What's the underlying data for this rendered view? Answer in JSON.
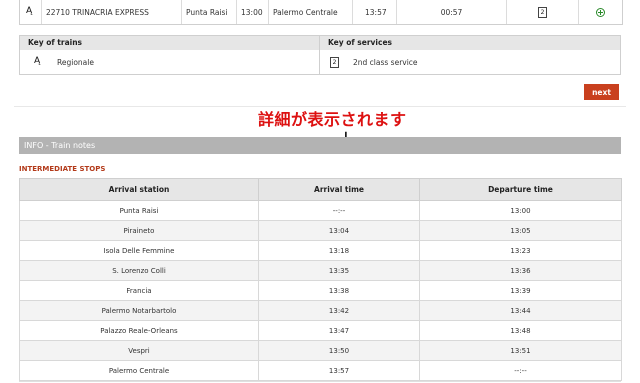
{
  "train_row": {
    "train": "22710 TRINACRIA EXPRESS",
    "from": "Punta Raisi",
    "departure": "13:00",
    "to": "Palermo Centrale",
    "arrival": "13:57",
    "duration": "00:57",
    "service_code": "2"
  },
  "key": {
    "trains_header": "Key of trains",
    "services_header": "Key of services",
    "train_label": "Regionale",
    "service_label": "2nd class service",
    "service_code": "2"
  },
  "next_button": "next",
  "annotation": {
    "text": "詳細が表示されます",
    "arrow": "↓"
  },
  "info_bar": "INFO - Train notes",
  "stops": {
    "title": "INTERMEDIATE STOPS",
    "columns": [
      "Arrival station",
      "Arrival time",
      "Departure time"
    ],
    "rows": [
      [
        "Punta Raisi",
        "--:--",
        "13:00"
      ],
      [
        "Piraineto",
        "13:04",
        "13:05"
      ],
      [
        "Isola Delle Femmine",
        "13:18",
        "13:23"
      ],
      [
        "S. Lorenzo Colli",
        "13:35",
        "13:36"
      ],
      [
        "Francia",
        "13:38",
        "13:39"
      ],
      [
        "Palermo Notarbartolo",
        "13:42",
        "13:44"
      ],
      [
        "Palazzo Reale-Orleans",
        "13:47",
        "13:48"
      ],
      [
        "Vespri",
        "13:50",
        "13:51"
      ],
      [
        "Palermo Centrale",
        "13:57",
        "--:--"
      ]
    ]
  },
  "colors": {
    "accent": "#c9401e",
    "section_title": "#b33a1a",
    "info_bar": "#b3b3b3",
    "annotation": "#dd1111",
    "plus_icon": "#2a8a2a"
  }
}
